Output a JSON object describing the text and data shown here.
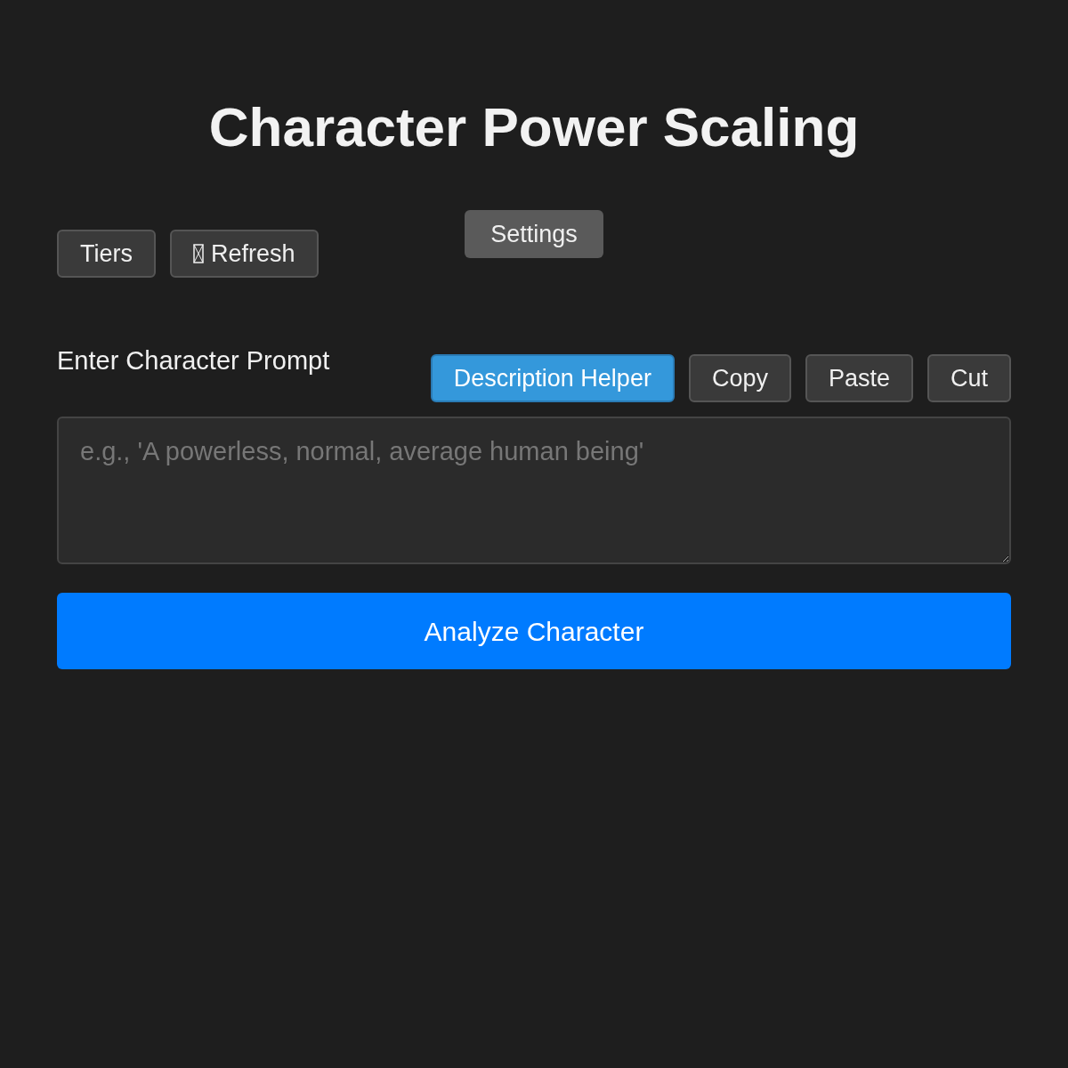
{
  "title": "Character Power Scaling",
  "nav_buttons": [
    {
      "label": "Tiers",
      "icon": false
    },
    {
      "label": "Refresh",
      "icon": true
    }
  ],
  "settings_button": {
    "label": "Settings"
  },
  "prompt": {
    "label": "Enter Character Prompt",
    "tools": [
      {
        "label": "Description Helper",
        "kind": "primary"
      },
      {
        "label": "Copy",
        "kind": "secondary"
      },
      {
        "label": "Paste",
        "kind": "secondary"
      },
      {
        "label": "Cut",
        "kind": "secondary"
      }
    ],
    "placeholder": "e.g., 'A powerless, normal, average human being'"
  },
  "analyze_button": {
    "label": "Analyze Character"
  }
}
